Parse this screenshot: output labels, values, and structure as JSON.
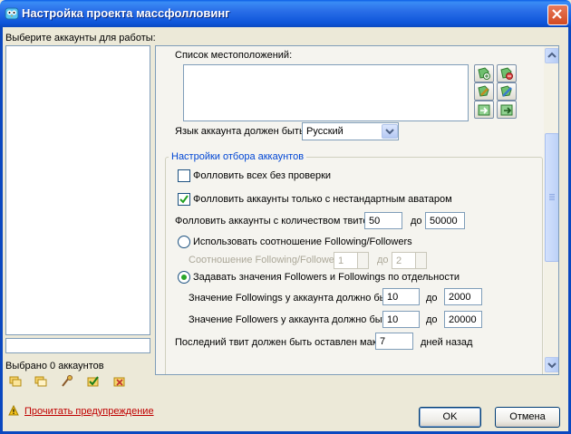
{
  "window": {
    "title": "Настройка проекта массфолловинг"
  },
  "left_panel": {
    "accounts_label": "Выберите аккаунты для работы:",
    "selected_count": "Выбрано 0 аккаунтов",
    "toolbar_icons": [
      "select-all-icon",
      "deselect-icon",
      "search-icon",
      "check-icon",
      "uncheck-icon"
    ]
  },
  "locations": {
    "label": "Список местоположений:"
  },
  "language": {
    "label": "Язык аккаунта должен быть:",
    "value": "Русский"
  },
  "filter_group": {
    "title": "Настройки отбора аккаунтов",
    "follow_all_label": "Фолловить всех без проверки",
    "follow_all_checked": false,
    "nonstandard_avatar_label": "Фолловить аккаунты только с нестандартным аватаром",
    "nonstandard_avatar_checked": true,
    "tweets_label": "Фолловить аккаунты с количеством твитов от:",
    "tweets_from": "50",
    "to_label": "до",
    "tweets_to": "50000",
    "ratio_radio_label": "Использовать соотношение Following/Followers",
    "ratio_label": "Соотношение Following/Followers от:",
    "ratio_from": "1",
    "ratio_to": "2",
    "separate_radio_label": "Задавать значения Followers и Followings по отдельности",
    "followings_label": "Значение Followings у аккаунта должно быть от:",
    "followings_from": "10",
    "followings_to": "2000",
    "followers_label": "Значение Followers у аккаунта должно быть от:",
    "followers_from": "10",
    "followers_to": "20000",
    "last_tweet_label": "Последний твит должен быть оставлен максимум:",
    "last_tweet_days": "7",
    "days_ago_label": "дней назад"
  },
  "footer": {
    "warning_link": "Прочитать предупреждение",
    "ok_label": "OK",
    "cancel_label": "Отмена"
  },
  "colors": {
    "titlebar": "#0a5ee6",
    "group_title": "#0046d5",
    "link": "#c00000"
  }
}
